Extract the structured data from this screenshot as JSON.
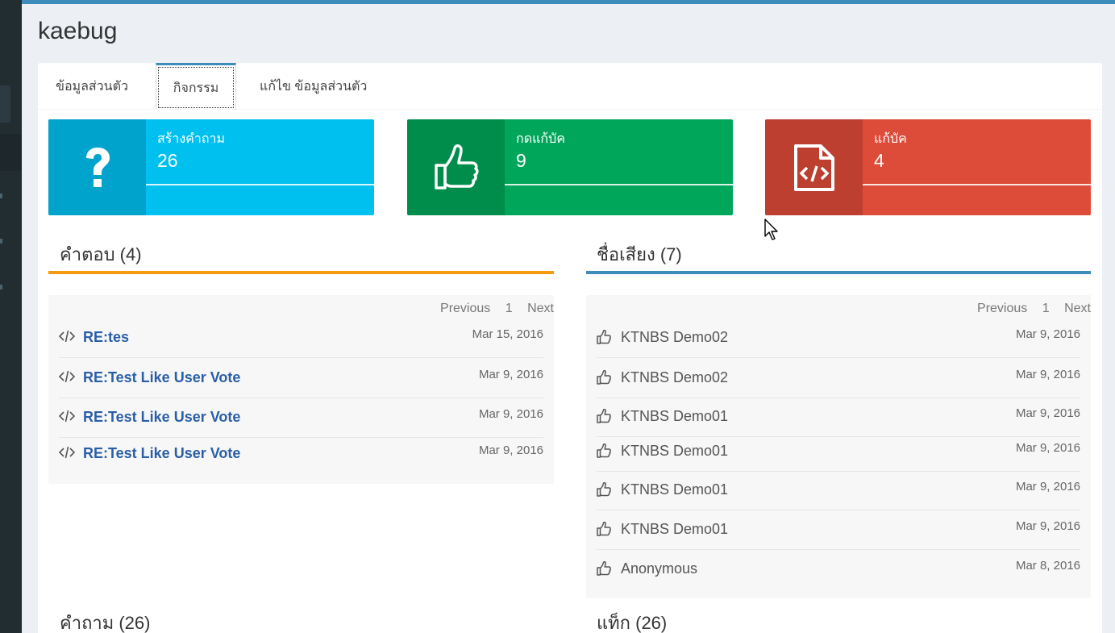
{
  "page": {
    "title": "kaebug"
  },
  "tabs": [
    "ข้อมูลส่วนตัว",
    "กิจกรรม",
    "แก้ไข ข้อมูลส่วนตัว"
  ],
  "stats": [
    {
      "label": "สร้างคำถาม",
      "value": "26",
      "icon": "question-icon",
      "color": "#00c0ef"
    },
    {
      "label": "กดแก้บัค",
      "value": "9",
      "icon": "thumbs-up-icon",
      "color": "#00a65a"
    },
    {
      "label": "แก้บัค",
      "value": "4",
      "icon": "code-file-icon",
      "color": "#dd4b39"
    }
  ],
  "answers": {
    "title": "คำตอบ (4)",
    "accent": "#f39c12",
    "pager": {
      "prev": "Previous",
      "page": "1",
      "next": "Next"
    },
    "items": [
      {
        "text": "RE:tes",
        "date": "Mar 15, 2016"
      },
      {
        "text": "RE:Test Like User Vote",
        "date": "Mar 9, 2016"
      },
      {
        "text": "RE:Test Like User Vote",
        "date": "Mar 9, 2016"
      },
      {
        "text": "RE:Test Like User Vote",
        "date": "Mar 9, 2016"
      }
    ]
  },
  "reputation": {
    "title": "ชื่อเสียง (7)",
    "accent": "#3c8dbc",
    "pager": {
      "prev": "Previous",
      "page": "1",
      "next": "Next"
    },
    "items": [
      {
        "text": "KTNBS Demo02",
        "date": "Mar 9, 2016"
      },
      {
        "text": "KTNBS Demo02",
        "date": "Mar 9, 2016"
      },
      {
        "text": "KTNBS Demo01",
        "date": "Mar 9, 2016"
      },
      {
        "text": "KTNBS Demo01",
        "date": "Mar 9, 2016"
      },
      {
        "text": "KTNBS Demo01",
        "date": "Mar 9, 2016"
      },
      {
        "text": "KTNBS Demo01",
        "date": "Mar 9, 2016"
      },
      {
        "text": "Anonymous",
        "date": "Mar 8, 2016"
      }
    ]
  },
  "questions": {
    "title": "คำถาม (26)"
  },
  "tags": {
    "title": "แท็ก (26)"
  }
}
